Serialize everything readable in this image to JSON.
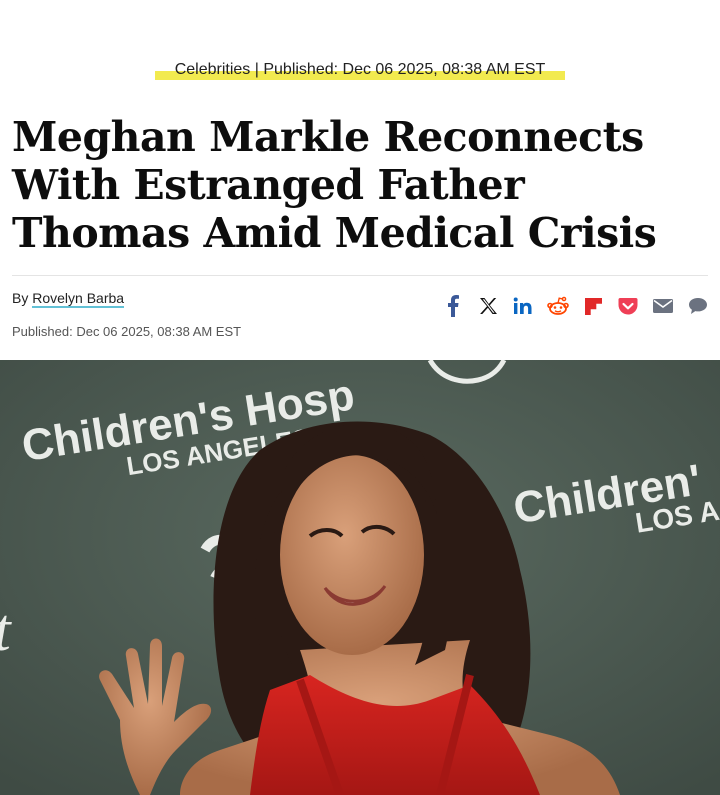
{
  "article": {
    "category": "Celebrities",
    "separator": " | ",
    "published_inline": "Published: Dec 06 2025, 08:38 AM EST",
    "headline": "Meghan Markle Reconnects With Estranged Father Thomas Amid Medical Crisis",
    "by_prefix": "By ",
    "author": "Rovelyn Barba",
    "published_line": "Published: Dec 06 2025, 08:38 AM EST"
  },
  "share_icons": [
    "facebook-icon",
    "x-icon",
    "linkedin-icon",
    "reddit-icon",
    "flipboard-icon",
    "pocket-icon",
    "email-icon",
    "comment-icon"
  ],
  "hero": {
    "backdrop_text_left_1": "Children's Hosp",
    "backdrop_text_left_2": "LOS ANGELES",
    "backdrop_text_right_1": "Children'",
    "backdrop_text_right_2": "LOS A",
    "colors": {
      "backdrop": "#4d5a52",
      "dress": "#c8201e",
      "skin": "#c48a64",
      "hair": "#2a1a14"
    }
  },
  "colors": {
    "highlight": "#f2ea4f",
    "author_underline": "#62c1d6",
    "facebook": "#3b5998",
    "linkedin": "#0a66c2",
    "reddit": "#ff4500",
    "flipboard": "#e12828",
    "pocket": "#ef3f56",
    "email": "#6b7280",
    "comment": "#6b7280"
  }
}
